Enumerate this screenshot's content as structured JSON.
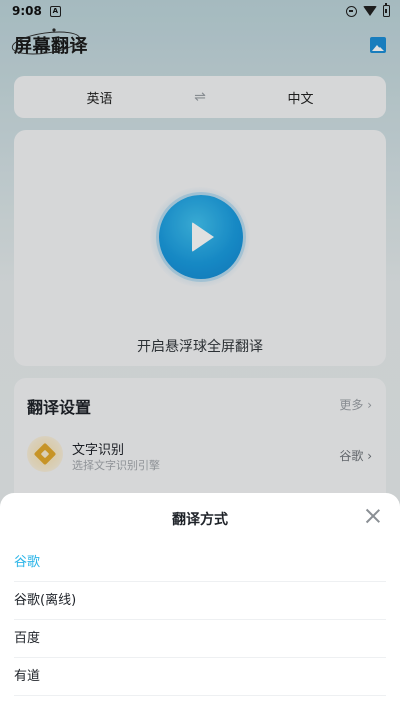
{
  "status_bar": {
    "time": "9:08",
    "notification_badge": "A"
  },
  "header": {
    "app_title": "屏幕翻译",
    "image_icon": "image-icon"
  },
  "language_bar": {
    "source": "英语",
    "target": "中文",
    "swap_icon": "⇌"
  },
  "hero": {
    "action_text": "开启悬浮球全屏翻译",
    "play_icon": "play-icon"
  },
  "settings": {
    "title": "翻译设置",
    "more_label": "更多 ›",
    "ocr": {
      "title": "文字识别",
      "subtitle": "选择文字识别引擎",
      "value": "谷歌 ›"
    }
  },
  "sheet": {
    "title": "翻译方式",
    "options": [
      {
        "label": "谷歌",
        "selected": true
      },
      {
        "label": "谷歌(离线)",
        "selected": false
      },
      {
        "label": "百度",
        "selected": false
      },
      {
        "label": "有道",
        "selected": false
      }
    ]
  },
  "colors": {
    "accent": "#2cb5e8",
    "play_blue": "#1a9ce0",
    "ocr_gold": "#e3a92c"
  }
}
